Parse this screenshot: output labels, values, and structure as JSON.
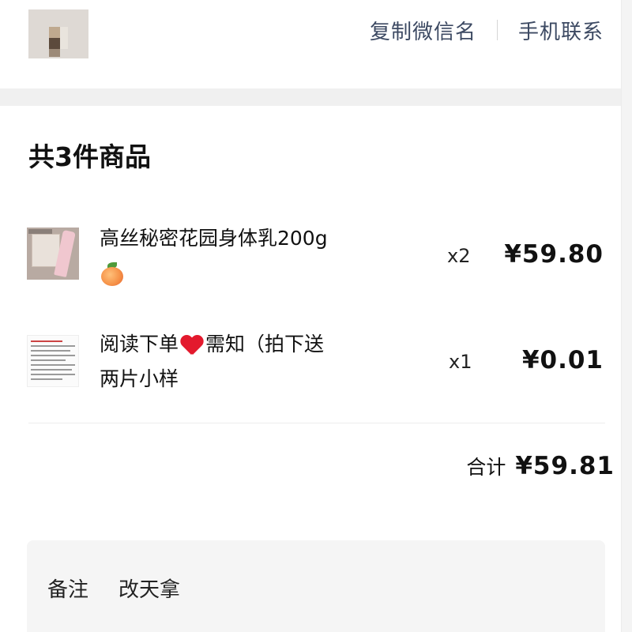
{
  "header": {
    "copy_wechat_label": "复制微信名",
    "phone_contact_label": "手机联系"
  },
  "goods": {
    "title": "共3件商品",
    "items": [
      {
        "name_line1": "高丝秘密花园身体乳200g",
        "emoji": "peach-emoji",
        "quantity": "x2",
        "price": "¥59.80",
        "thumbnail": "product-photo"
      },
      {
        "name_line1_before_emoji": "阅读下单",
        "emoji": "red-heart-emoji",
        "name_line1_after_emoji": "需知（拍下送",
        "name_line2": "两片小样",
        "quantity": "x1",
        "price": "¥0.01",
        "thumbnail": "text-document-screenshot"
      }
    ]
  },
  "summary": {
    "total_label": "合计",
    "total_value": "¥59.81"
  },
  "remark": {
    "label": "备注",
    "value": "改天拿"
  },
  "colors": {
    "link_text": "#3d4a63",
    "heart": "#e3192d",
    "section_band": "#f0f0f0",
    "remark_bg": "#f5f5f5"
  }
}
